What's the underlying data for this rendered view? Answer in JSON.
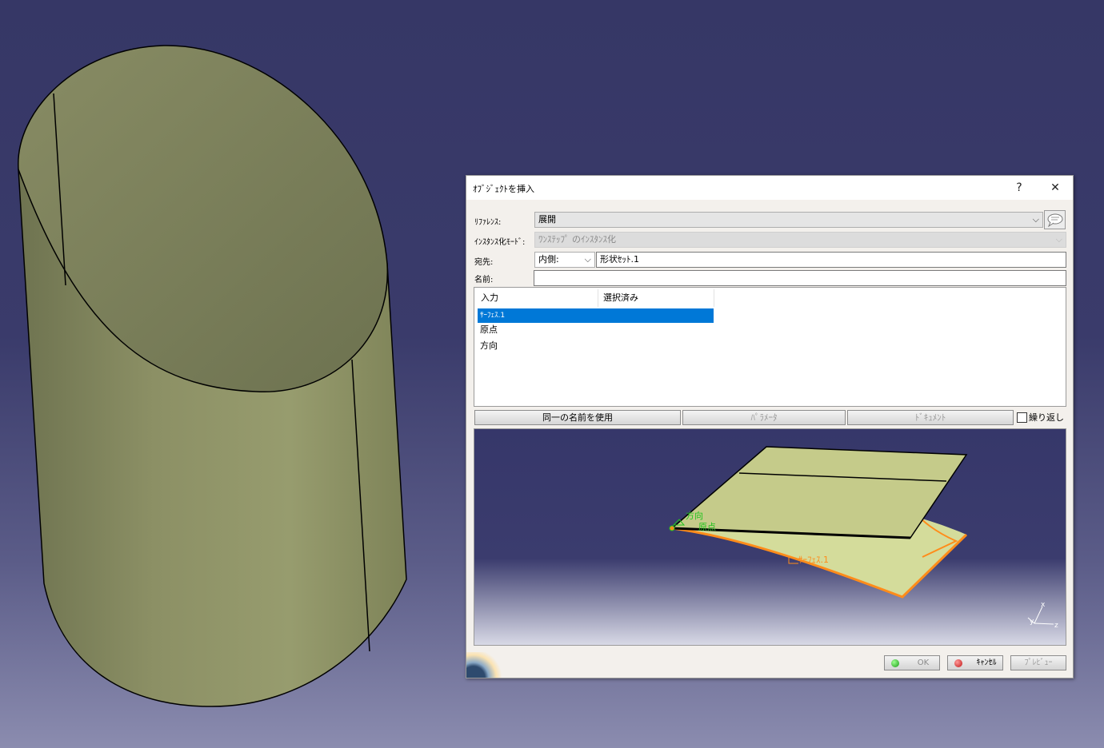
{
  "dialog": {
    "title": "ｵﾌﾞｼﾞｪｸﾄを挿入",
    "help": "?",
    "close": "✕",
    "reference": {
      "label": "ﾘﾌｧﾚﾝｽ:",
      "value": "展開"
    },
    "instantiation_mode": {
      "label": "ｲﾝｽﾀﾝｽ化ﾓｰﾄﾞ:",
      "value": "ﾜﾝｽﾃｯﾌﾟ のｲﾝｽﾀﾝｽ化"
    },
    "destination": {
      "label": "宛先:",
      "mode": "内側:",
      "value": "形状ｾｯﾄ.1"
    },
    "name": {
      "label": "名前:",
      "value": ""
    },
    "inputs_table": {
      "columns": [
        "入力",
        "選択済み"
      ],
      "rows": [
        "ｻｰﾌｪｽ.1",
        "原点",
        "方向"
      ],
      "selected_index": 0
    },
    "buttons": {
      "use_same_name": "同一の名前を使用",
      "parameters": "ﾊﾟﾗﾒｰﾀ",
      "documents": "ﾄﾞｷｭﾒﾝﾄ",
      "repeat": "繰り返し"
    },
    "preview_labels": {
      "direction": "方向",
      "origin": "原点",
      "surface": "ｻｰﾌｪｽ.1"
    },
    "axis_labels": {
      "x": "x",
      "y": "y",
      "z": "z"
    },
    "footer": {
      "ok": "OK",
      "cancel": "ｷｬﾝｾﾙ",
      "preview": "ﾌﾟﾚﾋﾞｭｰ"
    },
    "colors": {
      "selection": "#0078d7",
      "accent_green": "#22c31f",
      "accent_orange": "#ff8c1a"
    }
  }
}
